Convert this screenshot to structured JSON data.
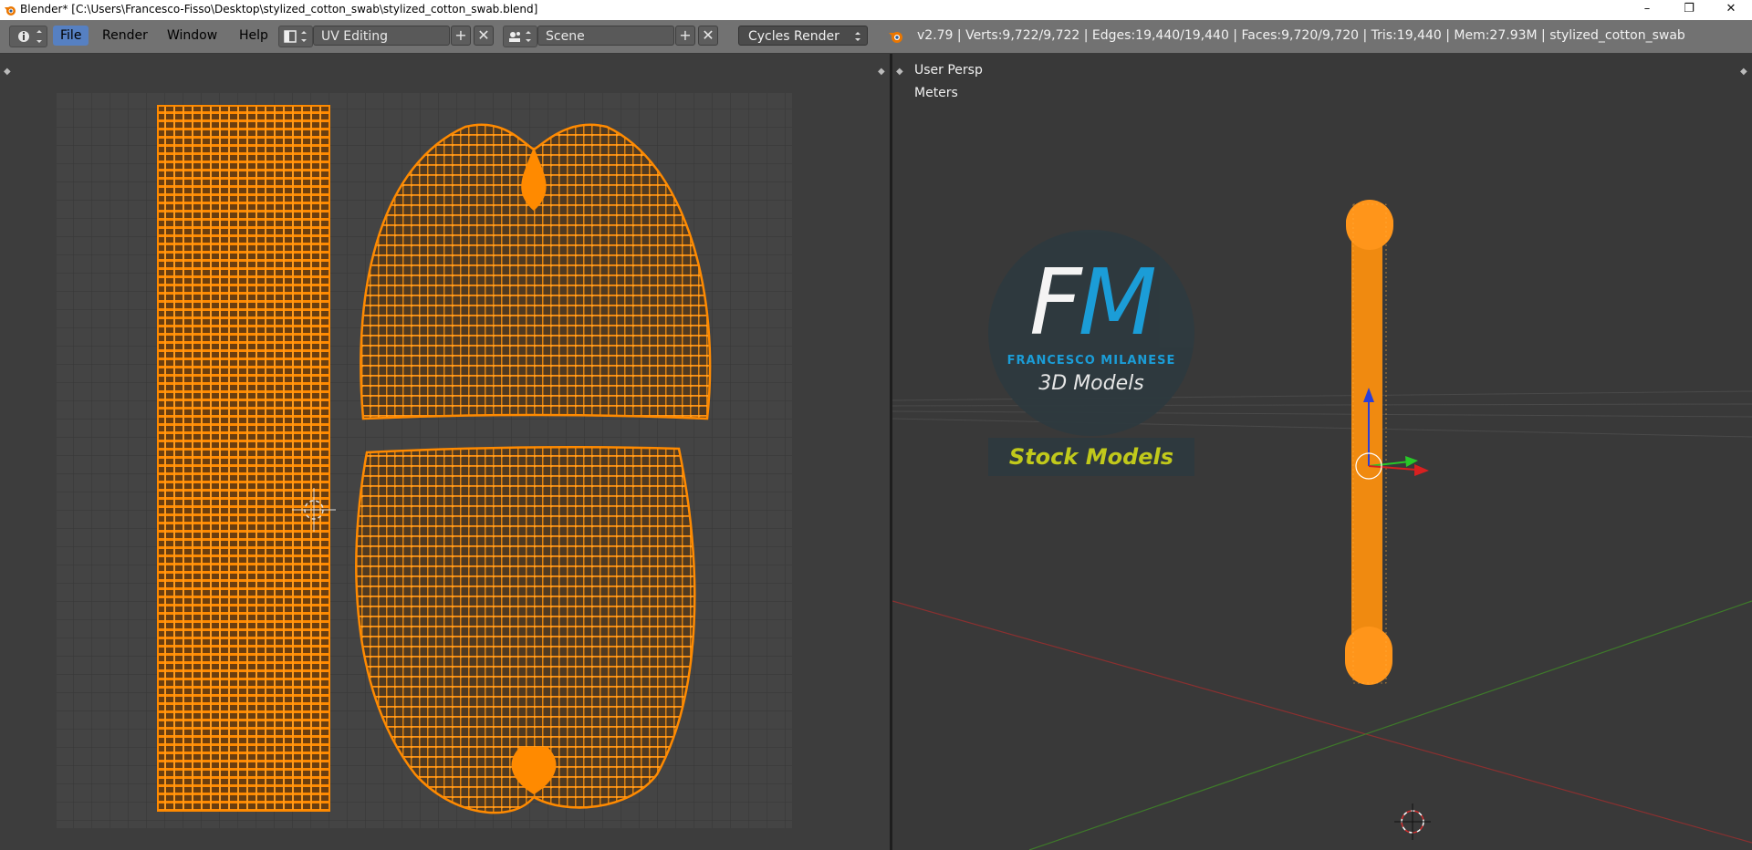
{
  "window": {
    "title": "Blender* [C:\\Users\\Francesco-Fisso\\Desktop\\stylized_cotton_swab\\stylized_cotton_swab.blend]",
    "controls": {
      "minimize": "–",
      "restore": "❐",
      "close": "✕"
    }
  },
  "header": {
    "menus": [
      {
        "label": "File",
        "active": true
      },
      {
        "label": "Render",
        "active": false
      },
      {
        "label": "Window",
        "active": false
      },
      {
        "label": "Help",
        "active": false
      }
    ],
    "screen_layout": "UV Editing",
    "scene": "Scene",
    "render_engine": "Cycles Render",
    "add_symbol": "+",
    "remove_symbol": "✕",
    "stats": "v2.79 | Verts:9,722/9,722 | Edges:19,440/19,440 | Faces:9,720/9,720 | Tris:19,440 | Mem:27.93M | stylized_cotton_swab"
  },
  "viewport": {
    "view_label": "User Persp",
    "units_label": "Meters"
  },
  "watermark": {
    "initials": "FM",
    "name": "FRANCESCO MILANESE",
    "tagline": "3D Models",
    "banner": "Stock Models"
  },
  "colors": {
    "accent_orange": "#ff8a00",
    "menu_active": "#5680c2",
    "logo_blue": "#1aa3e0",
    "banner_text": "#c9d11a"
  },
  "icons": {
    "info": "info-icon",
    "screen_layout": "screen-layout-icon",
    "scene": "scene-icon",
    "blender": "blender-logo-icon"
  }
}
